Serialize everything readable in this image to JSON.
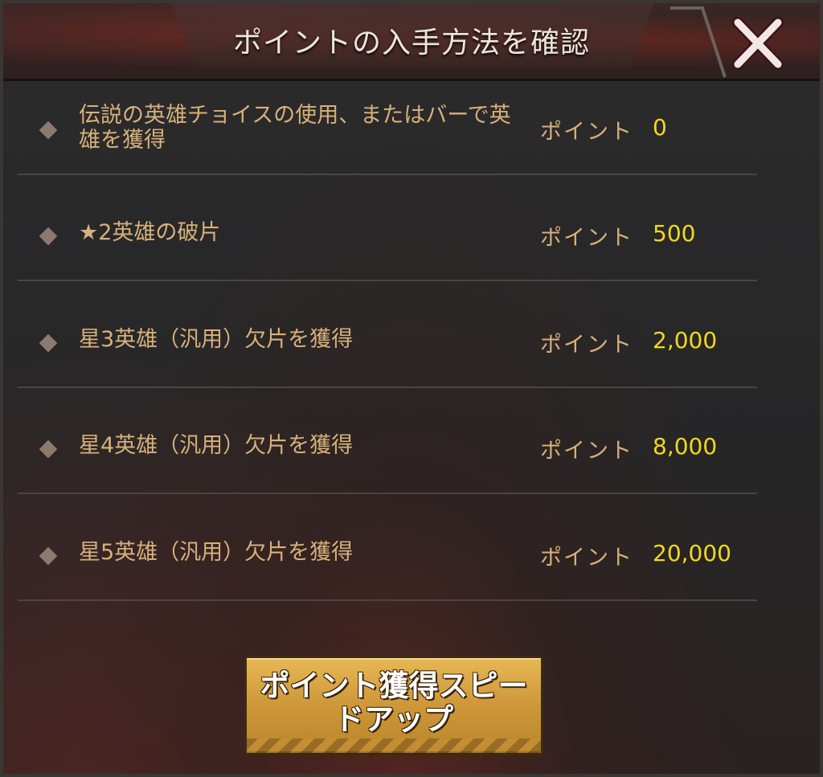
{
  "dialog": {
    "title": "ポイントの入手方法を確認",
    "close_icon": "close-x-icon"
  },
  "rows": [
    {
      "label": "伝説の英雄チョイスの使用、またはバーで英雄を獲得",
      "points_label": "ポイント",
      "points_value": "0"
    },
    {
      "label": "★2英雄の破片",
      "points_label": "ポイント",
      "points_value": "500"
    },
    {
      "label": "星3英雄（汎用）欠片を獲得",
      "points_label": "ポイント",
      "points_value": "2,000"
    },
    {
      "label": "星4英雄（汎用）欠片を獲得",
      "points_label": "ポイント",
      "points_value": "8,000"
    },
    {
      "label": "星5英雄（汎用）欠片を獲得",
      "points_label": "ポイント",
      "points_value": "20,000"
    }
  ],
  "action_button": {
    "label_line1": "ポイント獲得スピー",
    "label_line2": "ドアップ"
  },
  "colors": {
    "label": "#d8b07a",
    "value": "#f2d81e",
    "button": "#d09a3c"
  }
}
